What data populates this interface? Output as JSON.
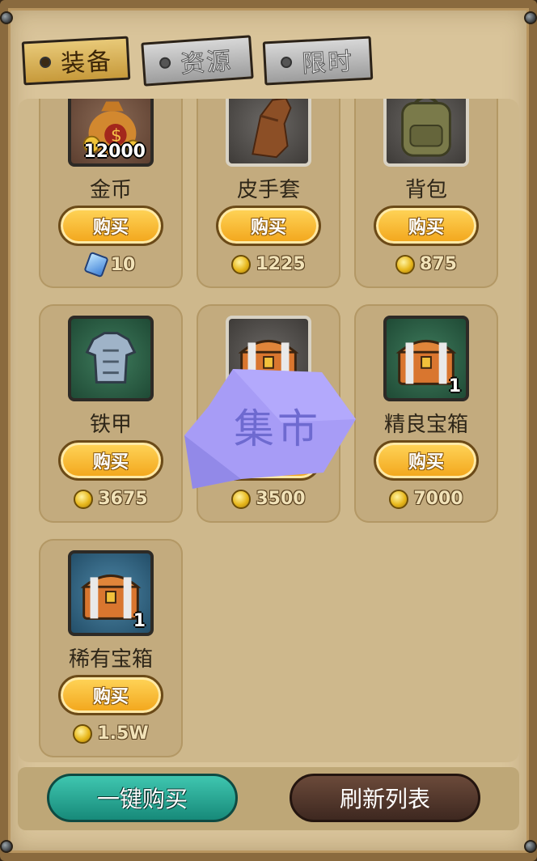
{
  "tabs": [
    {
      "label": "装备",
      "active": true
    },
    {
      "label": "资源",
      "active": false
    },
    {
      "label": "限时",
      "active": false
    }
  ],
  "items": [
    {
      "name": "金币",
      "qty": "12000",
      "buy": "购买",
      "currency": "gem",
      "price": "10",
      "icon": "money-bag-icon"
    },
    {
      "name": "皮手套",
      "qty": "",
      "buy": "购买",
      "currency": "coin",
      "price": "1225",
      "icon": "leather-glove-icon"
    },
    {
      "name": "背包",
      "qty": "",
      "buy": "购买",
      "currency": "coin",
      "price": "875",
      "icon": "backpack-icon"
    },
    {
      "name": "铁甲",
      "qty": "",
      "buy": "购买",
      "currency": "coin",
      "price": "3675",
      "icon": "iron-armor-icon"
    },
    {
      "name": "",
      "qty": "",
      "buy": "购买",
      "currency": "coin",
      "price": "3500",
      "icon": "treasure-chest-icon"
    },
    {
      "name": "精良宝箱",
      "qty": "1",
      "buy": "购买",
      "currency": "coin",
      "price": "7000",
      "icon": "treasure-chest-icon"
    },
    {
      "name": "稀有宝箱",
      "qty": "1",
      "buy": "购买",
      "currency": "coin",
      "price": "1.5W",
      "icon": "treasure-chest-icon"
    }
  ],
  "footer": {
    "buy_all": "一键购买",
    "refresh": "刷新列表"
  },
  "overlay": {
    "text": "集市",
    "color": "#a79cf6"
  }
}
